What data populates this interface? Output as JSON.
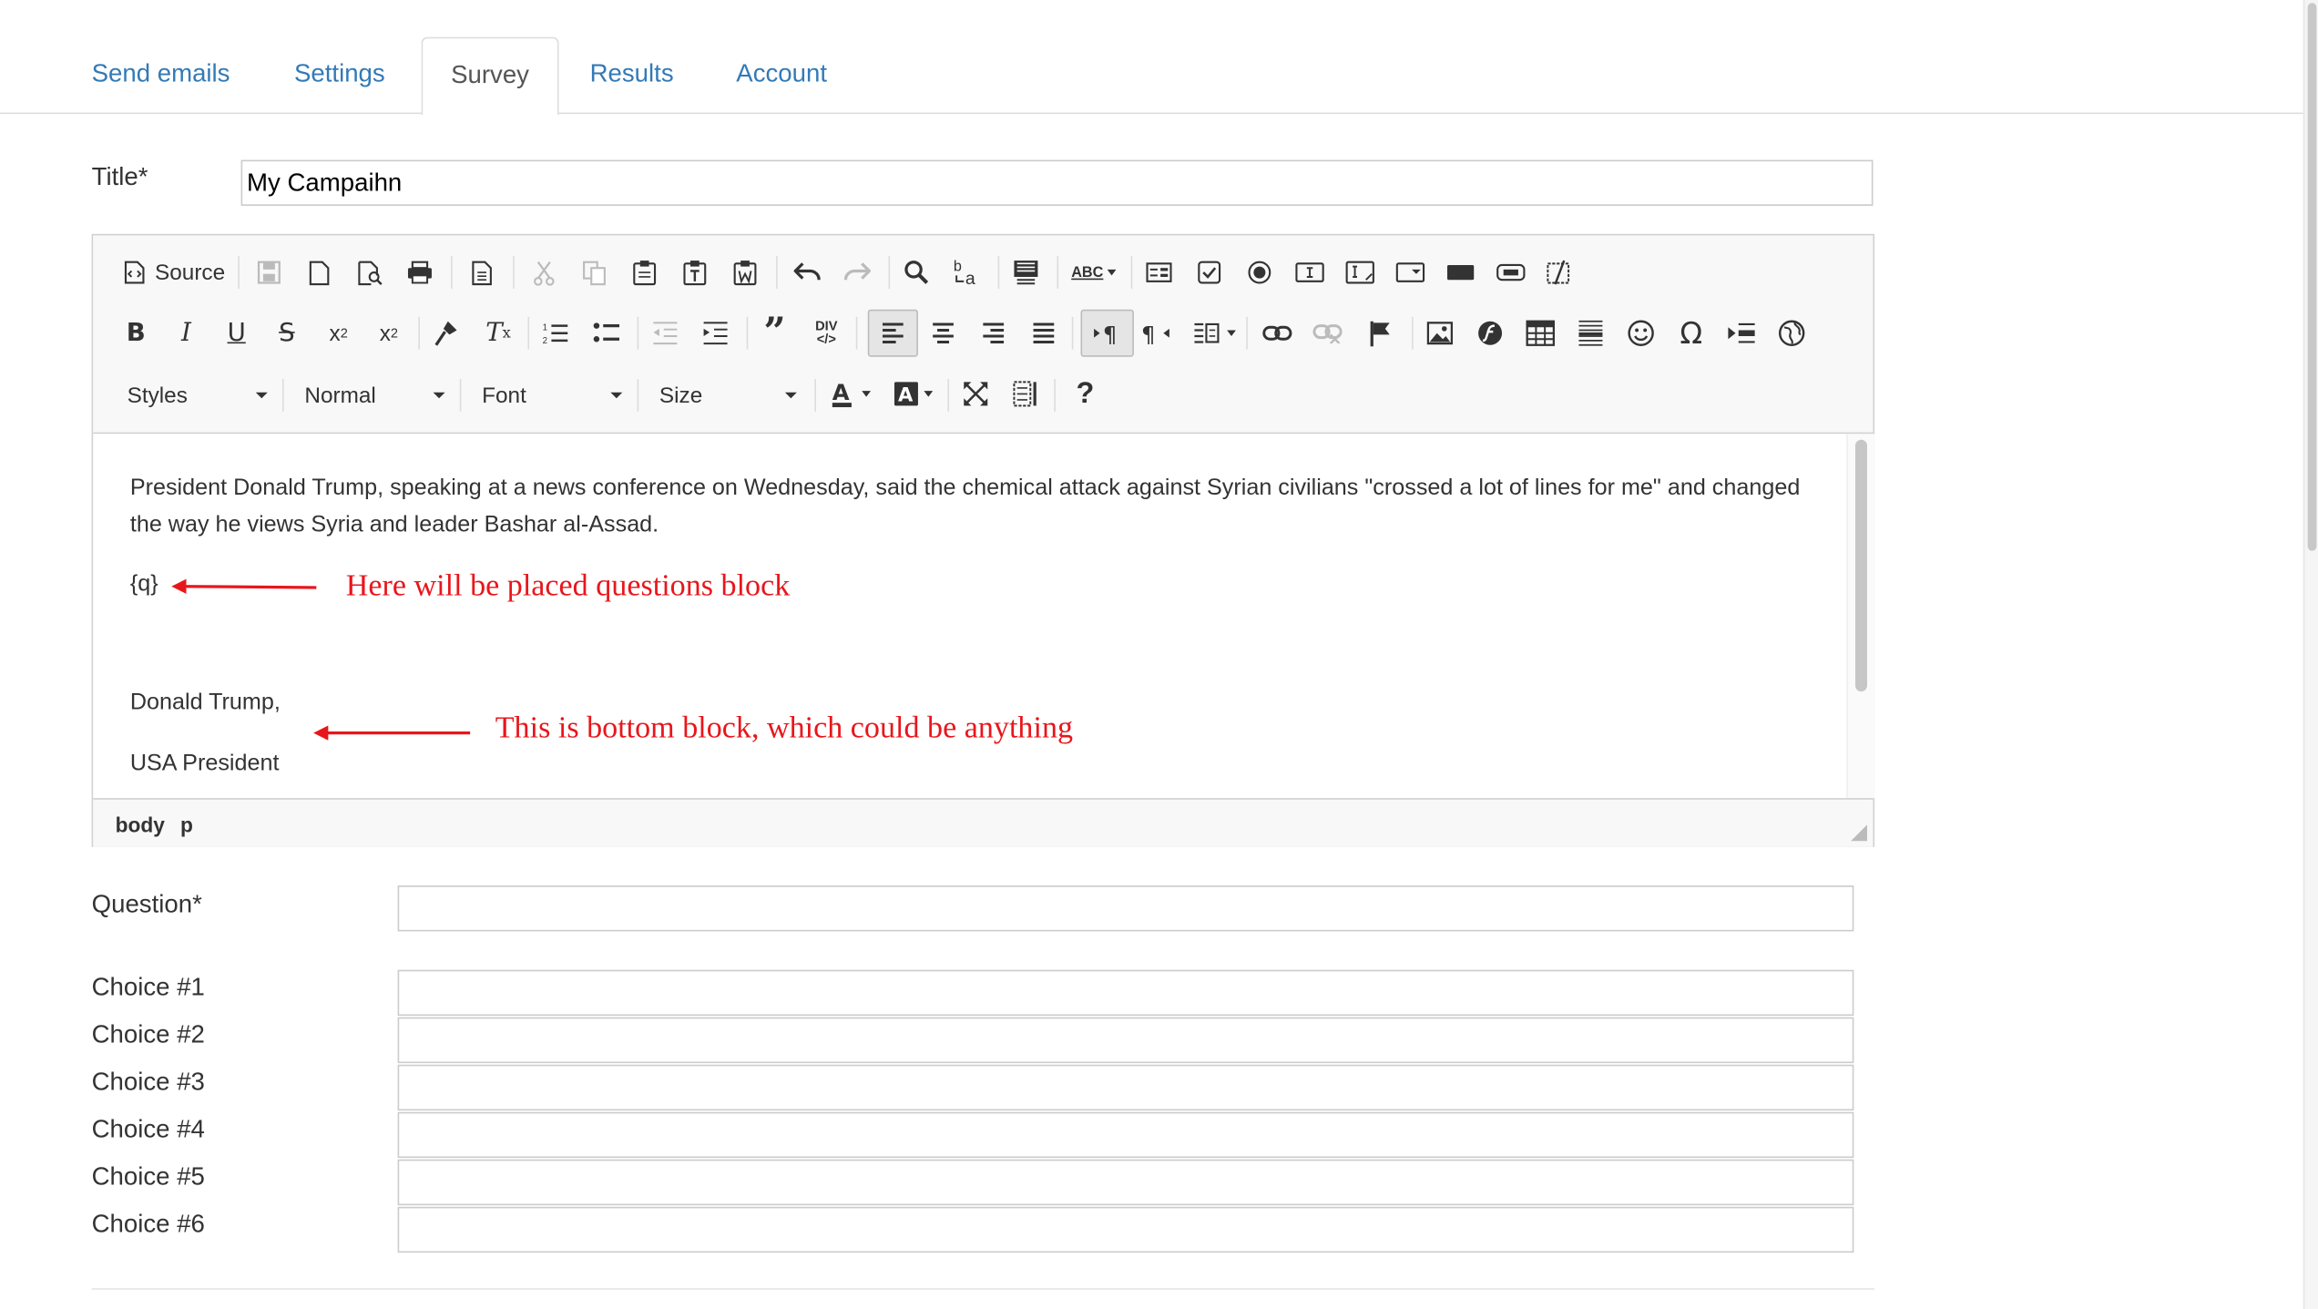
{
  "tabs": [
    {
      "label": "Send emails"
    },
    {
      "label": "Settings"
    },
    {
      "label": "Survey",
      "active": true
    },
    {
      "label": "Results"
    },
    {
      "label": "Account"
    }
  ],
  "form": {
    "title_label": "Title*",
    "title_value": "My Campaihn",
    "question_label": "Question*",
    "question_value": "",
    "choices": [
      {
        "label": "Choice #1",
        "value": ""
      },
      {
        "label": "Choice #2",
        "value": ""
      },
      {
        "label": "Choice #3",
        "value": ""
      },
      {
        "label": "Choice #4",
        "value": ""
      },
      {
        "label": "Choice #5",
        "value": ""
      },
      {
        "label": "Choice #6",
        "value": ""
      }
    ]
  },
  "editor": {
    "toolbar": {
      "source_label": "Source",
      "styles_label": "Styles",
      "format_label": "Normal",
      "font_label": "Font",
      "size_label": "Size",
      "spellcheck_label": "ABC",
      "div_label": "DIV",
      "help_label": "?"
    },
    "content": {
      "paragraph": "President Donald Trump, speaking at a news conference on Wednesday, said the chemical attack against Syrian civilians \"crossed a lot of lines for me\" and changed the way he views Syria and leader Bashar al-Assad.",
      "placeholder": "{q}",
      "signature_name": "Donald Trump,",
      "signature_title": "USA President"
    },
    "status_path": [
      "body",
      "p"
    ]
  },
  "annotations": {
    "questions_note": "Here will be placed questions block",
    "bottom_note": "This is bottom block, which could be anything",
    "color": "#e8161b"
  },
  "colors": {
    "link": "#337ab7",
    "annotation": "#e8161b"
  }
}
